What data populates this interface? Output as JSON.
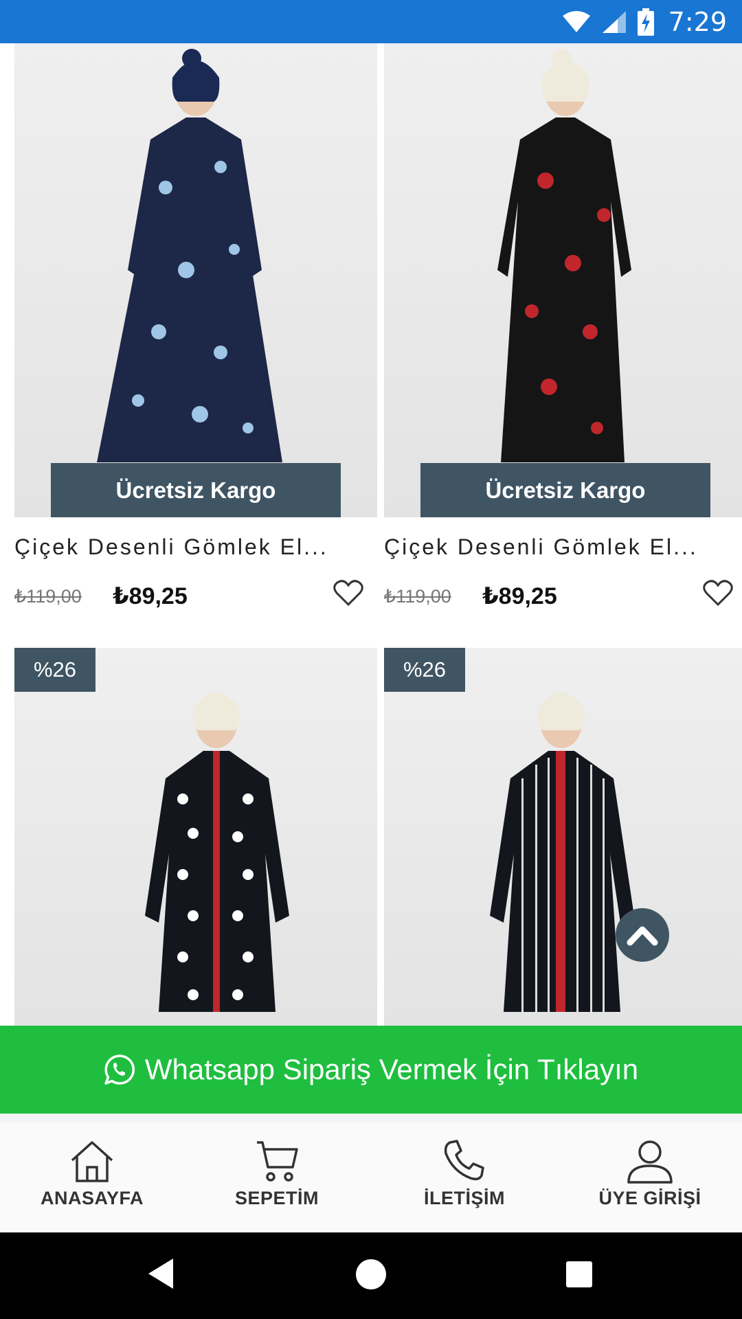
{
  "status_bar": {
    "time": "7:29",
    "icons": [
      "wifi-icon",
      "signal-icon",
      "battery-charging-icon"
    ],
    "color": "#1976d2"
  },
  "products": [
    {
      "title": "Çiçek Desenli Gömlek El...",
      "old_price": "₺119,00",
      "new_price": "₺89,25",
      "badge": "Ücretsiz Kargo"
    },
    {
      "title": "Çiçek Desenli Gömlek El...",
      "old_price": "₺119,00",
      "new_price": "₺89,25",
      "badge": "Ücretsiz Kargo"
    },
    {
      "discount": "%26"
    },
    {
      "discount": "%26"
    }
  ],
  "whatsapp": {
    "label": "Whatsapp Sipariş Vermek İçin Tıklayın",
    "color": "#1fbe3f"
  },
  "bottom_nav": {
    "items": [
      {
        "label": "ANASAYFA",
        "icon": "home-icon"
      },
      {
        "label": "SEPETİM",
        "icon": "cart-icon"
      },
      {
        "label": "İLETİŞİM",
        "icon": "phone-icon"
      },
      {
        "label": "ÜYE GİRİŞİ",
        "icon": "user-icon"
      }
    ]
  },
  "system_nav": {
    "icons": [
      "back-icon",
      "home-circle-icon",
      "recents-icon"
    ]
  },
  "accent_color": "#3f5563"
}
